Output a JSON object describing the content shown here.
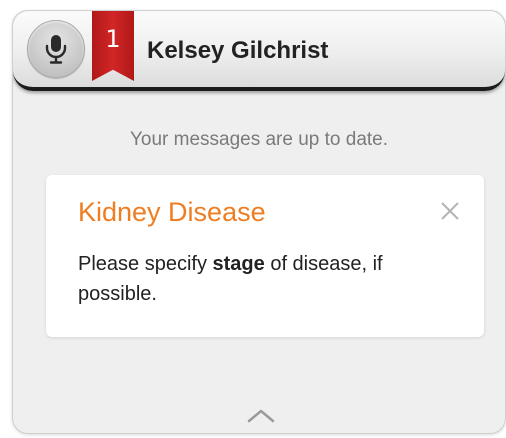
{
  "header": {
    "badge_count": "1",
    "contact_name": "Kelsey Gilchrist",
    "mic_icon": "microphone-icon"
  },
  "status": {
    "text": "Your messages are up to date."
  },
  "message": {
    "title": "Kidney Disease",
    "body_before": "Please specify ",
    "body_bold": "stage",
    "body_after": " of disease, if possible.",
    "close_icon": "close-icon"
  },
  "footer": {
    "expand_icon": "chevron-up-icon"
  },
  "colors": {
    "accent_orange": "#ef7d22",
    "badge_red": "#c81f1f",
    "panel_bg": "#efefef"
  }
}
